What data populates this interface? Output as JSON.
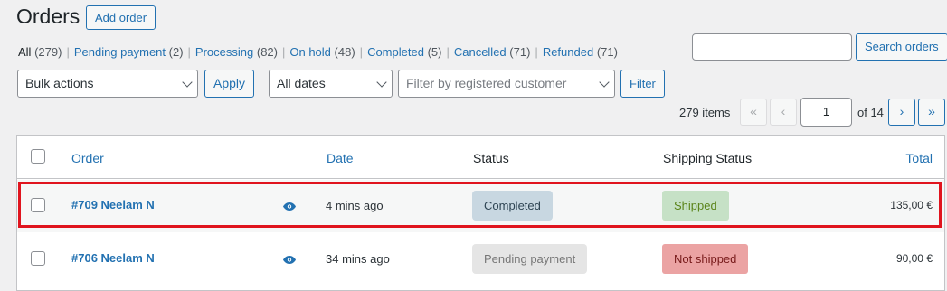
{
  "header": {
    "title": "Orders",
    "add_order_label": "Add order"
  },
  "status_filters": [
    {
      "label": "All",
      "count": "(279)",
      "current": true
    },
    {
      "label": "Pending payment",
      "count": "(2)"
    },
    {
      "label": "Processing",
      "count": "(82)"
    },
    {
      "label": "On hold",
      "count": "(48)"
    },
    {
      "label": "Completed",
      "count": "(5)"
    },
    {
      "label": "Cancelled",
      "count": "(71)"
    },
    {
      "label": "Refunded",
      "count": "(71)"
    }
  ],
  "search": {
    "value": "",
    "button_label": "Search orders"
  },
  "toolbar": {
    "bulk_actions": "Bulk actions",
    "apply_label": "Apply",
    "dates": "All dates",
    "customer_placeholder": "Filter by registered customer",
    "filter_label": "Filter"
  },
  "pagination": {
    "items": "279 items",
    "first": "«",
    "prev": "‹",
    "current_page": "1",
    "of_text": "of 14",
    "next": "›",
    "last": "»"
  },
  "table": {
    "columns": {
      "order": "Order",
      "date": "Date",
      "status": "Status",
      "shipping_status": "Shipping Status",
      "total": "Total"
    },
    "rows": [
      {
        "order": "#709 Neelam N",
        "date": "4 mins ago",
        "status": "Completed",
        "shipping": "Shipped",
        "total": "135,00 €"
      },
      {
        "order": "#706 Neelam N",
        "date": "34 mins ago",
        "status": "Pending payment",
        "shipping": "Not shipped",
        "total": "90,00 €"
      }
    ]
  },
  "colors": {
    "accent": "#2271b1",
    "highlight": "#e0141e",
    "status_completed_bg": "#c8d7e1",
    "status_pending_bg": "#e5e5e5",
    "shipped_bg": "#c6e1c6",
    "not_shipped_bg": "#eba3a3"
  }
}
